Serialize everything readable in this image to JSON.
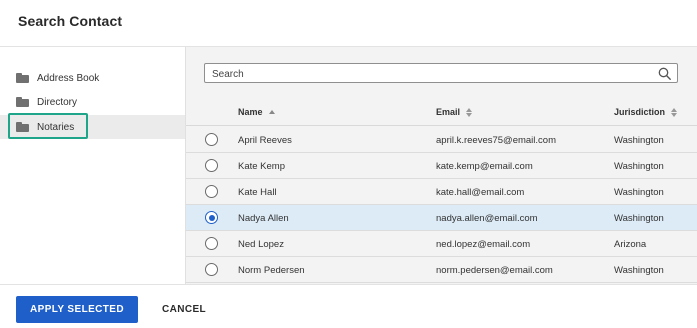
{
  "dialog": {
    "title": "Search Contact"
  },
  "sidebar": {
    "items": [
      {
        "label": "Address Book",
        "icon": "folder-icon",
        "selected": false
      },
      {
        "label": "Directory",
        "icon": "folder-icon",
        "selected": false
      },
      {
        "label": "Notaries",
        "icon": "folder-icon",
        "selected": true
      }
    ]
  },
  "search": {
    "placeholder": "Search",
    "value": "",
    "icon": "search-icon"
  },
  "table": {
    "columns": [
      {
        "label": "Name",
        "sort": "ascending"
      },
      {
        "label": "Email",
        "sort": "none"
      },
      {
        "label": "Jurisdiction",
        "sort": "none"
      }
    ],
    "rows": [
      {
        "name": "April Reeves",
        "email": "april.k.reeves75@email.com",
        "jurisdiction": "Washington",
        "selected": false
      },
      {
        "name": "Kate Kemp",
        "email": "kate.kemp@email.com",
        "jurisdiction": "Washington",
        "selected": false
      },
      {
        "name": "Kate Hall",
        "email": "kate.hall@email.com",
        "jurisdiction": "Washington",
        "selected": false
      },
      {
        "name": "Nadya Allen",
        "email": "nadya.allen@email.com",
        "jurisdiction": "Washington",
        "selected": true
      },
      {
        "name": "Ned Lopez",
        "email": "ned.lopez@email.com",
        "jurisdiction": "Arizona",
        "selected": false
      },
      {
        "name": "Norm Pedersen",
        "email": "norm.pedersen@email.com",
        "jurisdiction": "Washington",
        "selected": false
      }
    ]
  },
  "footer": {
    "apply_label": "APPLY SELECTED",
    "cancel_label": "CANCEL"
  },
  "colors": {
    "accent": "#1f5fc9",
    "selected_row": "#dcebf6",
    "focus_ring": "#1fa68a",
    "sidebar_selected": "#ebebeb"
  }
}
